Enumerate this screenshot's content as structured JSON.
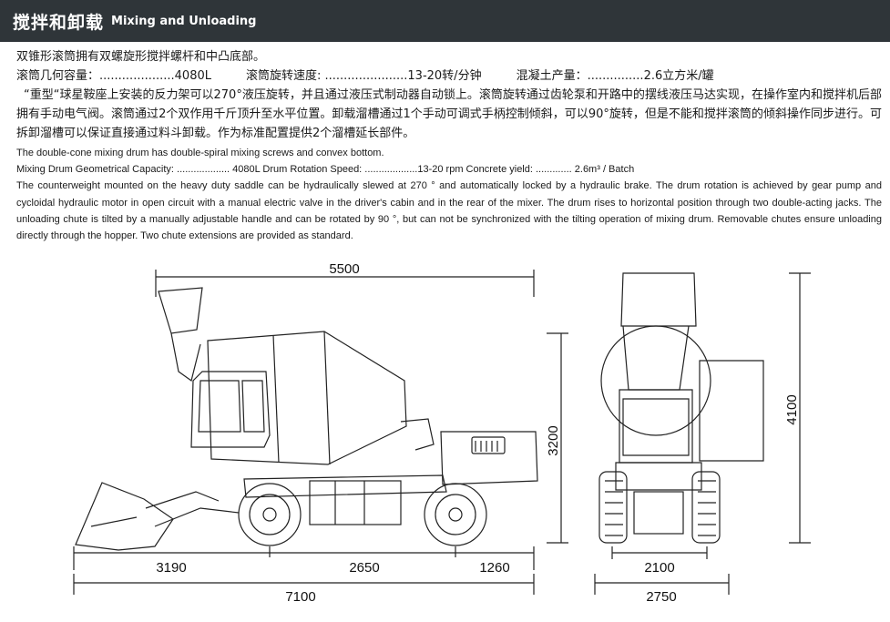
{
  "header": {
    "title_cn": "搅拌和卸载",
    "title_en": "Mixing and Unloading"
  },
  "cn": {
    "intro": "双锥形滚筒拥有双螺旋形搅拌螺杆和中凸底部。",
    "spec_capacity": "滚筒几何容量：....................4080L",
    "spec_speed": "滚筒旋转速度: ......................13-20转/分钟",
    "spec_yield": "混凝土产量：...............2.6立方米/罐",
    "paragraph": "“重型“球星鞍座上安装的反力架可以270°液压旋转，并且通过液压式制动器自动锁上。滚筒旋转通过齿轮泵和开路中的摆线液压马达实现，在操作室内和搅拌机后部拥有手动电气阀。滚筒通过2个双作用千斤顶升至水平位置。卸载溜槽通过1个手动可调式手柄控制倾斜，可以90°旋转，但是不能和搅拌滚筒的倾斜操作同步进行。可拆卸溜槽可以保证直接通过料斗卸载。作为标准配置提供2个溜槽延长部件。"
  },
  "en": {
    "intro": "The double-cone mixing drum has double-spiral mixing  screws and convex bottom.",
    "spec_line": "Mixing Drum Geometrical Capacity: ................... 4080L Drum Rotation Speed: ...................13-20 rpm Concrete yield: ............. 2.6m³ / Batch",
    "paragraph": "The counterweight mounted on the heavy duty saddle can be hydraulically slewed at 270 ° and automatically locked by a hydraulic brake. The drum rotation is achieved by gear pump and cycloidal hydraulic motor in open circuit with a manual electric valve in the driver's cabin and in the rear of the mixer. The drum rises to horizontal position through two double-acting jacks. The unloading chute is tilted by a manually adjustable handle and can be rotated by 90 °, but can not be synchronized with the tilting operation of mixing drum. Removable chutes ensure unloading directly through the hopper. Two chute extensions are provided as standard."
  },
  "dimensions": {
    "overall_length_top": "5500",
    "height_side": "3200",
    "front_overhang": "3190",
    "wheelbase": "2650",
    "rear_overhang": "1260",
    "total_length": "7100",
    "height_front_view": "4100",
    "track_width": "2100",
    "overall_width": "2750"
  }
}
